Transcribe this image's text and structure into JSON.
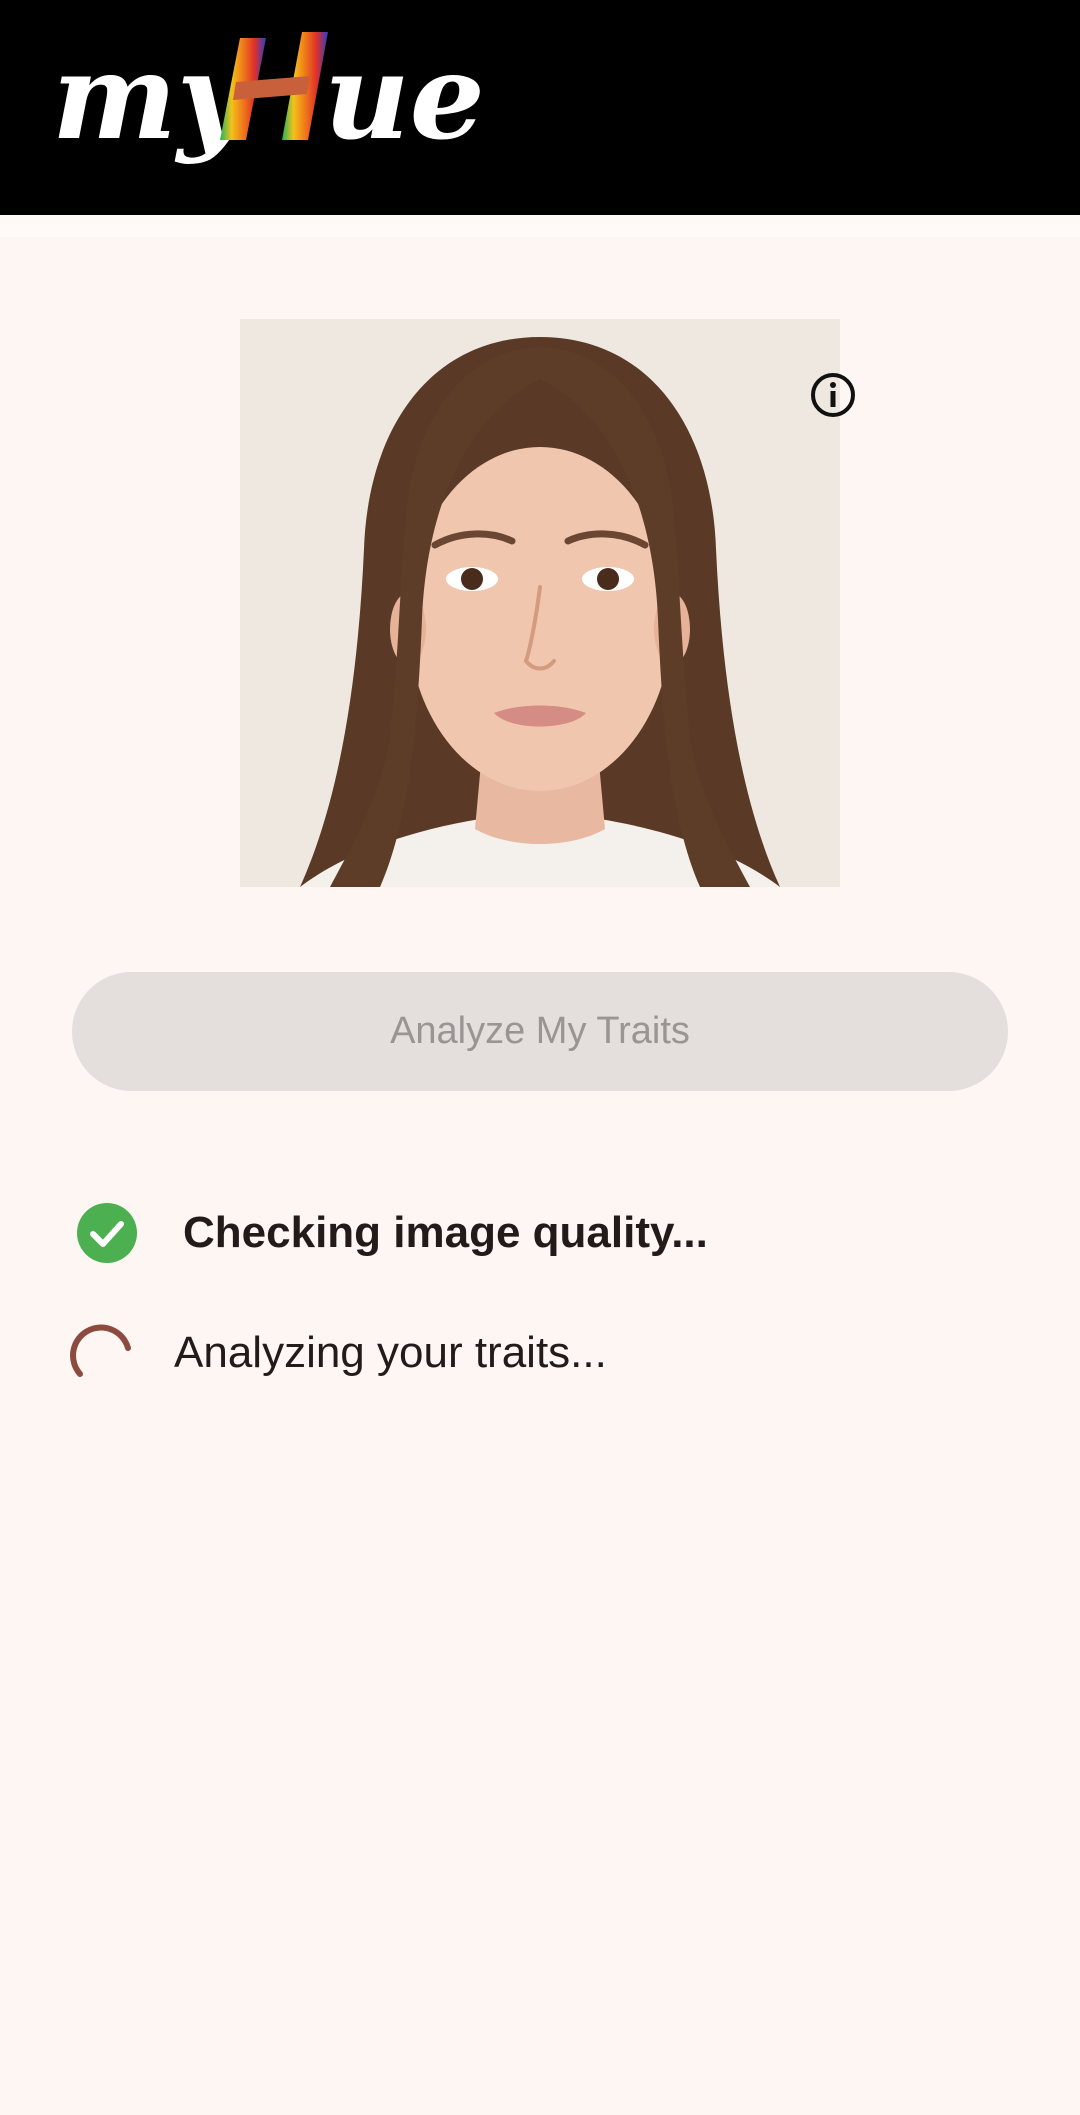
{
  "app_bar": {
    "logo_text": "myHue",
    "background": "#000000"
  },
  "photo": {
    "description_icon": "info-icon"
  },
  "actions": {
    "analyze_label": "Analyze My Traits",
    "analyze_enabled": false
  },
  "progress": {
    "steps": [
      {
        "label": "Checking image quality...",
        "status": "done",
        "icon": "check-circle-icon",
        "color": "#4caf50"
      },
      {
        "label": "Analyzing your traits...",
        "status": "in-progress",
        "icon": "spinner-icon",
        "color": "#8d4a3f"
      }
    ]
  },
  "colors": {
    "page_background": "#fdf6f3",
    "button_background": "#e4dedc",
    "button_text": "#9a9494",
    "text": "#231a19"
  }
}
